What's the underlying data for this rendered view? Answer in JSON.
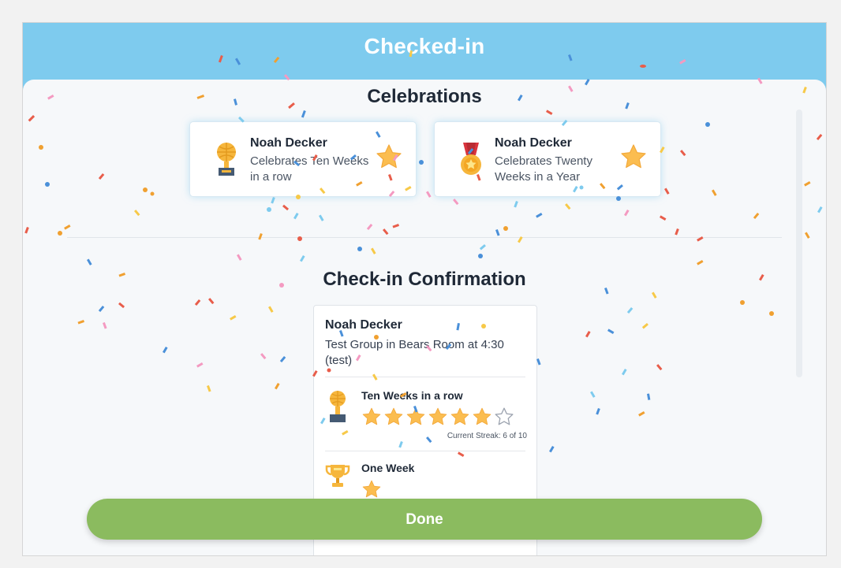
{
  "header": {
    "title": "Checked-in"
  },
  "celebrations": {
    "title": "Celebrations",
    "items": [
      {
        "name": "Noah Decker",
        "description": "Celebrates Ten Weeks in a row",
        "icon": "globe-trophy-icon"
      },
      {
        "name": "Noah Decker",
        "description": "Celebrates Twenty Weeks in a Year",
        "icon": "medal-icon"
      }
    ]
  },
  "confirmation": {
    "title": "Check-in Confirmation",
    "person": {
      "name": "Noah Decker",
      "detail": "Test Group in Bears Room at 4:30 (test)"
    },
    "achievements": [
      {
        "title": "Ten Weeks in a row",
        "icon": "globe-trophy-icon",
        "stars_filled": 6,
        "stars_total": 7,
        "streak": "Current Streak: 6 of 10"
      },
      {
        "title": "One Week",
        "icon": "cup-trophy-icon",
        "stars_filled": 1,
        "stars_total": 1
      }
    ]
  },
  "footer": {
    "done_label": "Done"
  },
  "colors": {
    "header_bg": "#7ecbee",
    "panel_bg": "#f6f8fa",
    "done_button": "#8bbb5f",
    "star": "#fbbd50"
  }
}
